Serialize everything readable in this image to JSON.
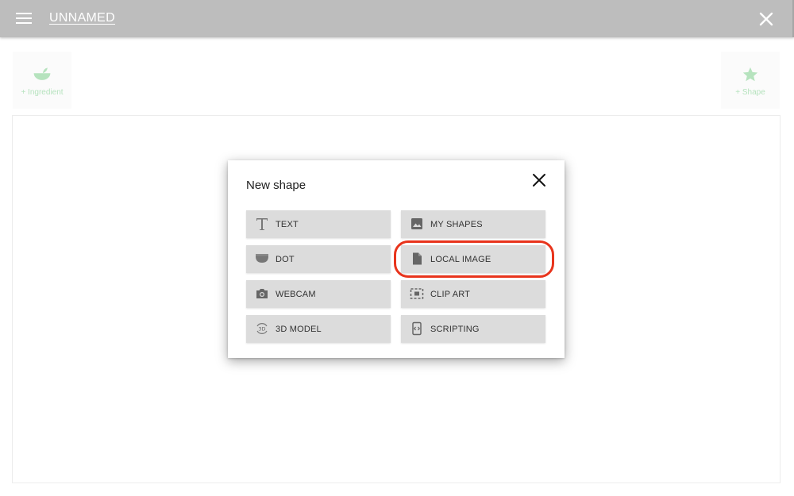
{
  "app": {
    "title": "UNNAMED"
  },
  "icons": {
    "menu": "hamburger-menu-icon",
    "close": "close-icon",
    "ingredient": "bowl-icon",
    "shape": "star-icon"
  },
  "toolbar": {
    "ingredient_label": "+ Ingredient",
    "shape_label": "+ Shape"
  },
  "dialog": {
    "title": "New shape",
    "options": [
      {
        "label": "TEXT",
        "icon": "text-t-icon"
      },
      {
        "label": "MY SHAPES",
        "icon": "image-icon"
      },
      {
        "label": "DOT",
        "icon": "dot-projector-icon"
      },
      {
        "label": "LOCAL IMAGE",
        "icon": "file-icon"
      },
      {
        "label": "WEBCAM",
        "icon": "camera-icon"
      },
      {
        "label": "CLIP ART",
        "icon": "clip-art-icon"
      },
      {
        "label": "3D MODEL",
        "icon": "3d-rotation-icon"
      },
      {
        "label": "SCRIPTING",
        "icon": "scripting-icon"
      }
    ]
  },
  "colors": {
    "topbar": "#bdbdbd",
    "accent_green": "#b6e3be",
    "highlight": "#e8341c",
    "option_bg": "#dcdcdc"
  }
}
